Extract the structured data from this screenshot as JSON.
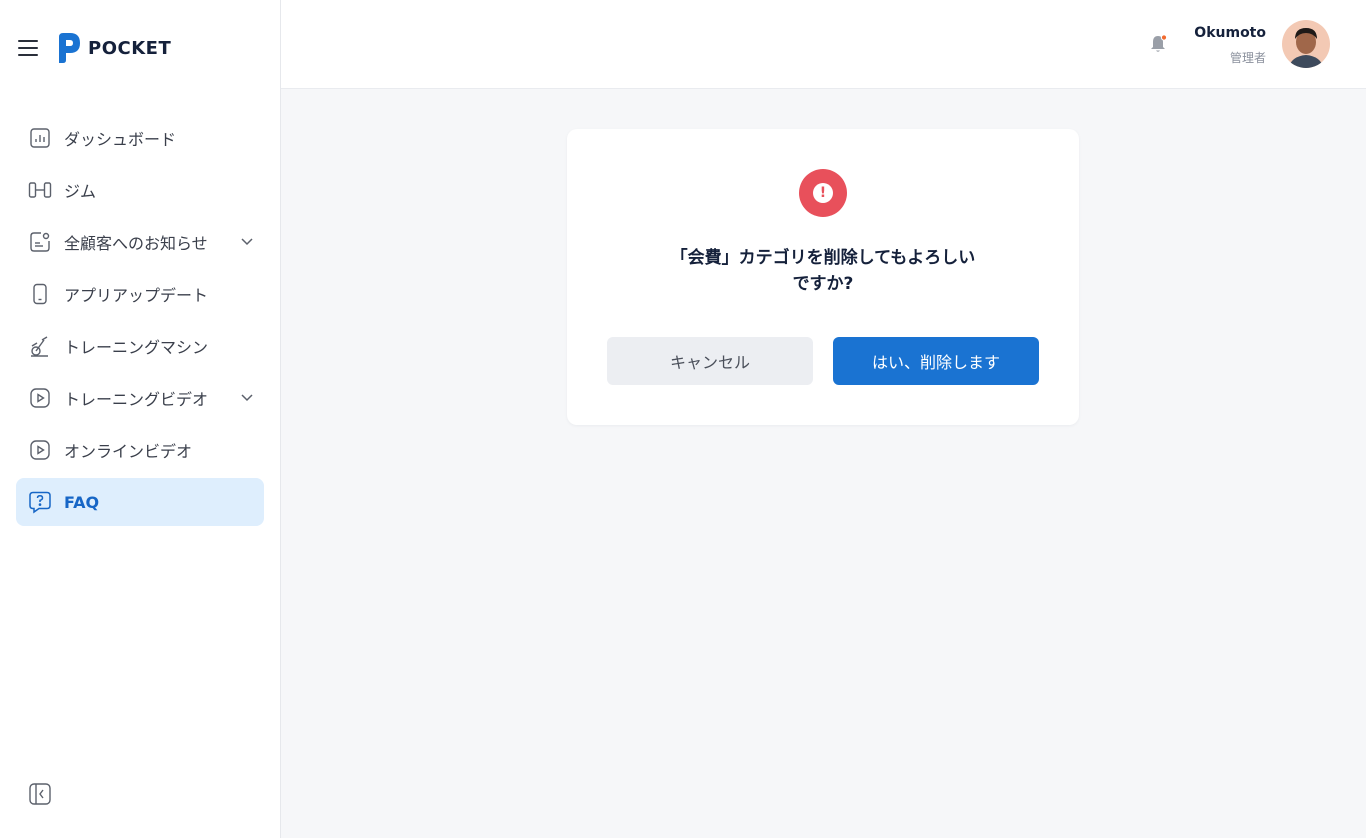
{
  "brand": {
    "logo_text": "POCKET"
  },
  "sidebar": {
    "items": [
      {
        "label": "ダッシュボード",
        "icon": "bar-chart-icon",
        "has_chevron": false,
        "active": false
      },
      {
        "label": "ジム",
        "icon": "dumbbell-icon",
        "has_chevron": false,
        "active": false
      },
      {
        "label": "全顧客へのお知らせ",
        "icon": "announcement-icon",
        "has_chevron": true,
        "active": false
      },
      {
        "label": "アプリアップデート",
        "icon": "smartphone-icon",
        "has_chevron": false,
        "active": false
      },
      {
        "label": "トレーニングマシン",
        "icon": "exercise-bike-icon",
        "has_chevron": false,
        "active": false
      },
      {
        "label": "トレーニングビデオ",
        "icon": "video-play-icon",
        "has_chevron": true,
        "active": false
      },
      {
        "label": "オンラインビデオ",
        "icon": "video-play-icon",
        "has_chevron": false,
        "active": false
      },
      {
        "label": "FAQ",
        "icon": "question-bubble-icon",
        "has_chevron": false,
        "active": true
      }
    ]
  },
  "header": {
    "user_name": "Okumoto",
    "user_role": "管理者",
    "notification_dot_color": "#f26a2e"
  },
  "dialog": {
    "message": "「会費」カテゴリを削除してもよろしいですか?",
    "cancel_label": "キャンセル",
    "confirm_label": "はい、削除します"
  },
  "colors": {
    "accent": "#1a73d2",
    "danger": "#e8505b",
    "active_bg": "#deeefd"
  }
}
